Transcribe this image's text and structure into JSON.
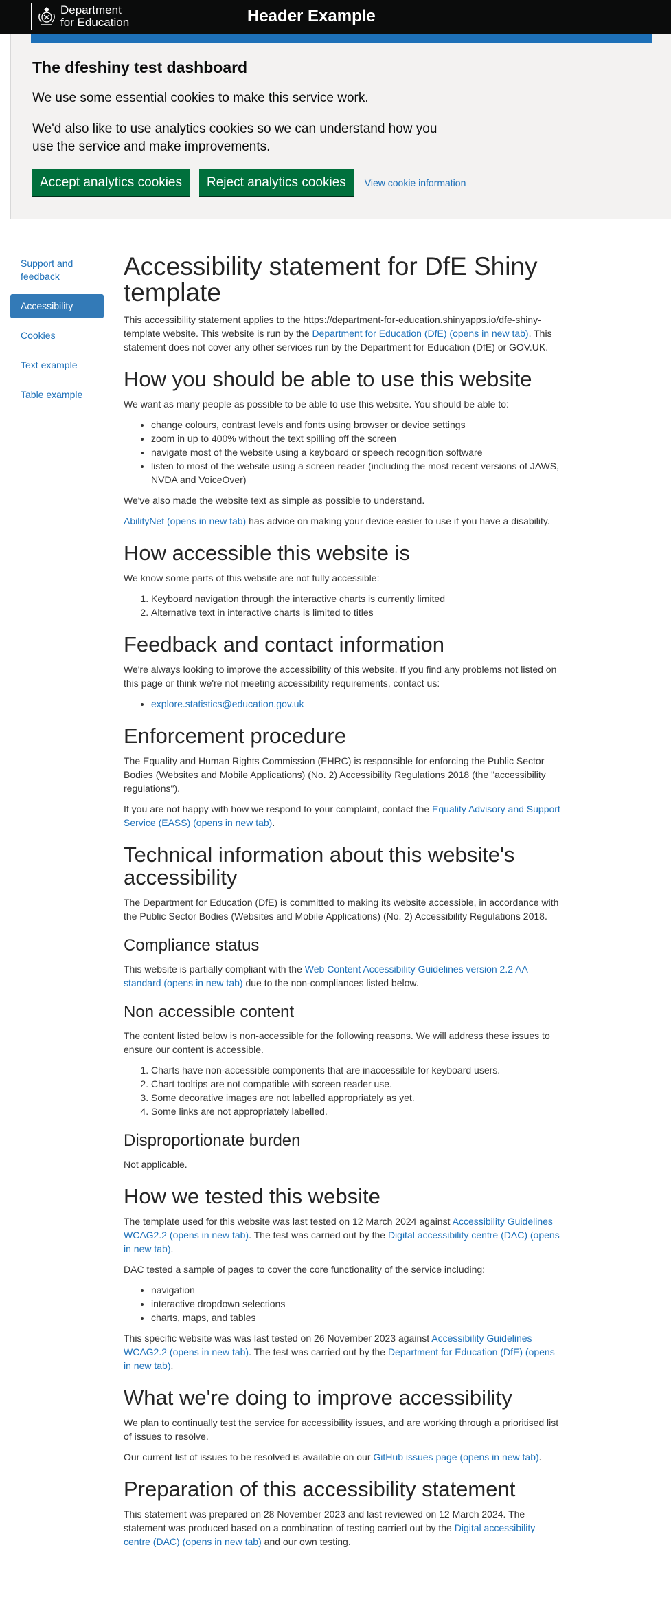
{
  "header": {
    "logo_line1": "Department",
    "logo_line2": "for Education",
    "title": "Header Example"
  },
  "cookies": {
    "title": "The dfeshiny test dashboard",
    "p1": "We use some essential cookies to make this service work.",
    "p2": "We'd also like to use analytics cookies so we can understand how you use the service and make improvements.",
    "accept": "Accept analytics cookies",
    "reject": "Reject analytics cookies",
    "view": "View cookie information"
  },
  "nav": {
    "support": "Support and feedback",
    "accessibility": "Accessibility",
    "cookies": "Cookies",
    "text": "Text example",
    "table": "Table example"
  },
  "content": {
    "title": "Accessibility statement for DfE Shiny template",
    "intro_a": "This accessibility statement applies to the https://department-for-education.shinyapps.io/dfe-shiny-template website. This website is run by the ",
    "intro_link": "Department for Education (DfE) (opens in new tab)",
    "intro_b": ". This statement does not cover any other services run by the Department for Education (DfE) or GOV.UK.",
    "s1_title": "How you should be able to use this website",
    "s1_p": "We want as many people as possible to be able to use this website. You should be able to:",
    "s1_list": [
      "change colours, contrast levels and fonts using browser or device settings",
      "zoom in up to 400% without the text spilling off the screen",
      "navigate most of the website using a keyboard or speech recognition software",
      "listen to most of the website using a screen reader (including the most recent versions of JAWS, NVDA and VoiceOver)"
    ],
    "s1_p2": "We've also made the website text as simple as possible to understand.",
    "s1_link": "AbilityNet (opens in new tab)",
    "s1_p3": " has advice on making your device easier to use if you have a disability.",
    "s2_title": "How accessible this website is",
    "s2_p": "We know some parts of this website are not fully accessible:",
    "s2_list": [
      "Keyboard navigation through the interactive charts is currently limited",
      "Alternative text in interactive charts is limited to titles"
    ],
    "s3_title": "Feedback and contact information",
    "s3_p": "We're always looking to improve the accessibility of this website. If you find any problems not listed on this page or think we're not meeting accessibility requirements, contact us:",
    "s3_email": "explore.statistics@education.gov.uk",
    "s4_title": "Enforcement procedure",
    "s4_p": "The Equality and Human Rights Commission (EHRC) is responsible for enforcing the Public Sector Bodies (Websites and Mobile Applications) (No. 2) Accessibility Regulations 2018 (the \"accessibility regulations\").",
    "s4_p2a": "If you are not happy with how we respond to your complaint, contact the ",
    "s4_link": "Equality Advisory and Support Service (EASS) (opens in new tab)",
    "s4_p2b": ".",
    "s5_title": "Technical information about this website's accessibility",
    "s5_p": "The Department for Education (DfE) is committed to making its website accessible, in accordance with the Public Sector Bodies (Websites and Mobile Applications) (No. 2) Accessibility Regulations 2018.",
    "s6_title": "Compliance status",
    "s6_pa": "This website is partially compliant with the ",
    "s6_link": "Web Content Accessibility Guidelines version 2.2 AA standard (opens in new tab)",
    "s6_pb": " due to the non-compliances listed below.",
    "s7_title": "Non accessible content",
    "s7_p": "The content listed below is non-accessible for the following reasons. We will address these issues to ensure our content is accessible.",
    "s7_list": [
      "Charts have non-accessible components that are inaccessible for keyboard users.",
      "Chart tooltips are not compatible with screen reader use.",
      "Some decorative images are not labelled appropriately as yet.",
      "Some links are not appropriately labelled."
    ],
    "s8_title": "Disproportionate burden",
    "s8_p": "Not applicable.",
    "s9_title": "How we tested this website",
    "s9_pa": "The template used for this website was last tested on 12 March 2024 against ",
    "s9_link1": "Accessibility Guidelines WCAG2.2 (opens in new tab)",
    "s9_pb": ". The test was carried out by the ",
    "s9_link2": "Digital accessibility centre (DAC) (opens in new tab)",
    "s9_pc": ".",
    "s9_p2": "DAC tested a sample of pages to cover the core functionality of the service including:",
    "s9_list": [
      "navigation",
      "interactive dropdown selections",
      "charts, maps, and tables"
    ],
    "s9_p3a": "This specific website was was last tested on 26 November 2023 against ",
    "s9_link3": "Accessibility Guidelines WCAG2.2 (opens in new tab)",
    "s9_p3b": ". The test was carried out by the ",
    "s9_link4": "Department for Education (DfE) (opens in new tab)",
    "s9_p3c": ".",
    "s10_title": "What we're doing to improve accessibility",
    "s10_p": "We plan to continually test the service for accessibility issues, and are working through a prioritised list of issues to resolve.",
    "s10_p2a": "Our current list of issues to be resolved is available on our ",
    "s10_link": "GitHub issues page (opens in new tab)",
    "s10_p2b": ".",
    "s11_title": "Preparation of this accessibility statement",
    "s11_pa": "This statement was prepared on 28 November 2023 and last reviewed on 12 March 2024. The statement was produced based on a combination of testing carried out by the ",
    "s11_link": "Digital accessibility centre (DAC) (opens in new tab)",
    "s11_pb": " and our own testing."
  }
}
